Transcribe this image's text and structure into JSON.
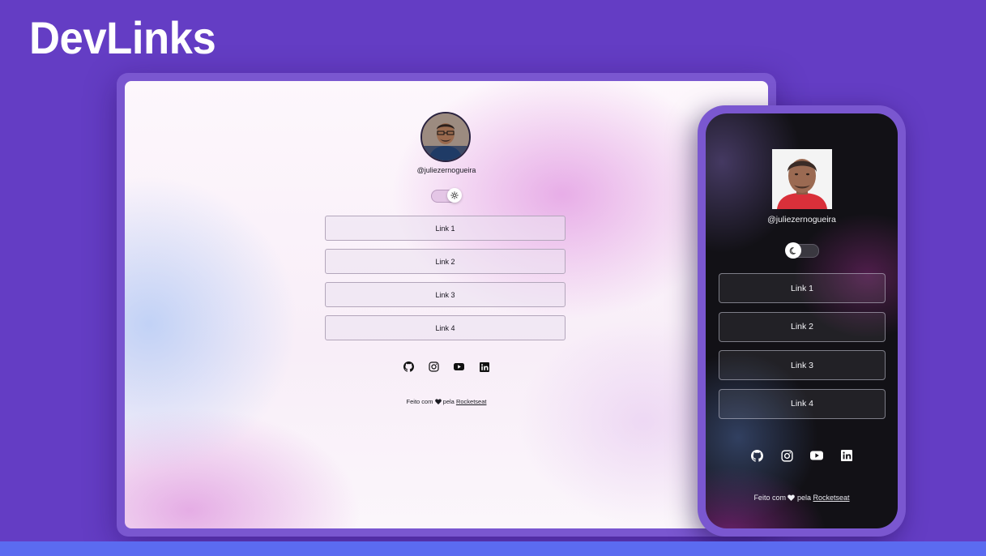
{
  "page": {
    "title": "DevLinks"
  },
  "desktop": {
    "username": "@juliezernogueira",
    "theme_toggle_icon": "sun-icon",
    "links": [
      {
        "label": "Link 1"
      },
      {
        "label": "Link 2"
      },
      {
        "label": "Link 3"
      },
      {
        "label": "Link 4"
      }
    ],
    "social": [
      "github-icon",
      "instagram-icon",
      "youtube-icon",
      "linkedin-icon"
    ],
    "footer": {
      "prefix": "Feito com",
      "middle": "pela",
      "link": "Rocketseat",
      "heart_icon": "heart-icon"
    }
  },
  "mobile": {
    "username": "@juliezernogueira",
    "theme_toggle_icon": "moon-icon",
    "links": [
      {
        "label": "Link 1"
      },
      {
        "label": "Link 2"
      },
      {
        "label": "Link 3"
      },
      {
        "label": "Link 4"
      }
    ],
    "social": [
      "github-icon",
      "instagram-icon",
      "youtube-icon",
      "linkedin-icon"
    ],
    "footer": {
      "prefix": "Feito com",
      "middle": "pela",
      "link": "Rocketseat",
      "heart_icon": "heart-icon"
    }
  },
  "colors": {
    "background": "#643dc4",
    "frame": "#7a57d0",
    "bottom_bar": "#5b6bf0",
    "mobile_screen": "#121116"
  }
}
